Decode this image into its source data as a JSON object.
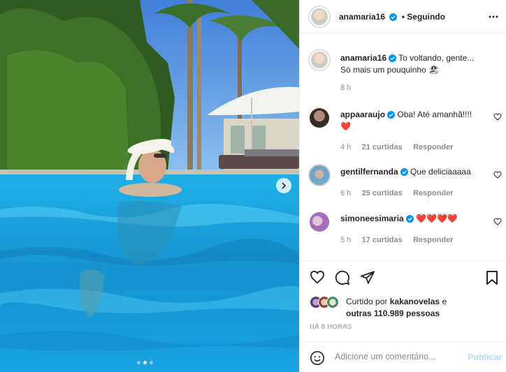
{
  "post": {
    "author": "anamaria16",
    "follow_status": "• Seguindo",
    "caption_line1": "To voltando, gente...",
    "caption_line2": "Só mais um pouquinho 🏖",
    "caption_time": "8 h",
    "time_ago": "HÁ 8 HORAS",
    "liked_by_prefix": "Curtido por",
    "liked_by_user": "kakanovelas",
    "liked_by_suffix": "e",
    "liked_by_others": "outras 110.989 pessoas"
  },
  "comments": [
    {
      "user": "appaaraujo",
      "text": "Oba! Até amanhã!!!!",
      "extra": "❤️",
      "time": "4 h",
      "likes": "21 curtidas",
      "reply": "Responder"
    },
    {
      "user": "gentilfernanda",
      "text": "Que deliciaaaaa",
      "time": "6 h",
      "likes": "25 curtidas",
      "reply": "Responder"
    },
    {
      "user": "simoneesimaria",
      "text": "❤️❤️❤️❤️",
      "time": "5 h",
      "likes": "17 curtidas",
      "reply": "Responder"
    }
  ],
  "comment_box": {
    "placeholder": "Adicione um comentário...",
    "publish_label": "Publicar"
  },
  "colors": {
    "verified": "#0095f6",
    "publish": "#b3dbff",
    "like_red": "#ed4956"
  },
  "icons": [
    "heart-icon",
    "comment-icon",
    "share-icon",
    "bookmark-icon",
    "emoji-icon",
    "more-icon",
    "verified-badge-icon",
    "chevron-right-icon"
  ],
  "carousel": {
    "slides": 3,
    "active_index": 1
  }
}
